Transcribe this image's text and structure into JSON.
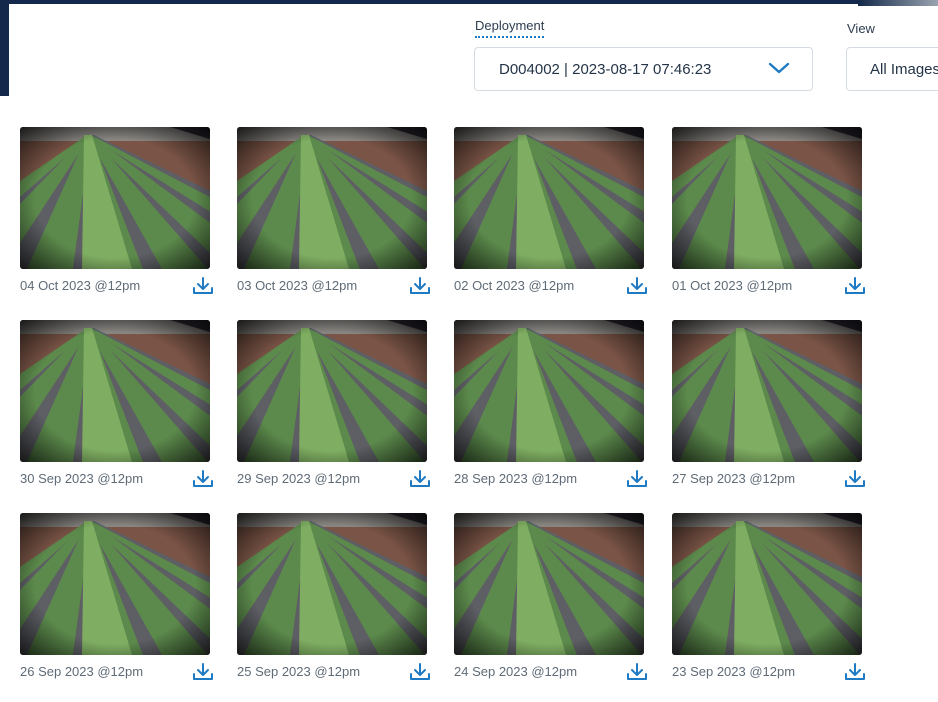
{
  "filters": {
    "deployment_label": "Deployment",
    "deployment_value": "D004002 | 2023-08-17 07:46:23",
    "view_label": "View",
    "view_value": "All Images"
  },
  "icons": {
    "dropdown": "chevron-down-icon",
    "download": "download-icon"
  },
  "colors": {
    "accent": "#1f7ac4",
    "header": "#13284a"
  },
  "images": [
    {
      "caption": "04 Oct 2023 @12pm"
    },
    {
      "caption": "03 Oct 2023 @12pm"
    },
    {
      "caption": "02 Oct 2023 @12pm"
    },
    {
      "caption": "01 Oct 2023 @12pm"
    },
    {
      "caption": "30 Sep 2023 @12pm"
    },
    {
      "caption": "29 Sep 2023 @12pm"
    },
    {
      "caption": "28 Sep 2023 @12pm"
    },
    {
      "caption": "27 Sep 2023 @12pm"
    },
    {
      "caption": "26 Sep 2023 @12pm"
    },
    {
      "caption": "25 Sep 2023 @12pm"
    },
    {
      "caption": "24 Sep 2023 @12pm"
    },
    {
      "caption": "23 Sep 2023 @12pm"
    }
  ]
}
